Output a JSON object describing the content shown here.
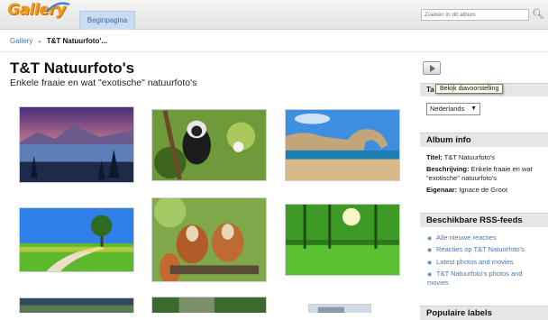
{
  "app": {
    "logo": "Gallery",
    "search_placeholder": "Zoeken in dit album"
  },
  "nav": {
    "home_tab": "Beginpagina"
  },
  "breadcrumb": {
    "root": "Gallery",
    "separator": "»",
    "current": "T&T Natuurfoto'..."
  },
  "album": {
    "title": "T&T Natuurfoto's",
    "description": "Enkele fraaie en wat \"exotische\" natuurfoto's"
  },
  "sidebar": {
    "slideshow_tooltip": "Bekijk diavoorstelling",
    "language_heading": "Ta",
    "language_selected": "Nederlands",
    "album_info": {
      "heading": "Album info",
      "title_label": "Titel:",
      "title_value": "T&T Natuurfoto's",
      "desc_label": "Beschrijving:",
      "desc_value": "Enkele fraaie en wat \"exotische\" natuurfoto's",
      "owner_label": "Eigenaar:",
      "owner_value": "Ignace de Groot"
    },
    "rss": {
      "heading": "Beschikbare RSS-feeds",
      "items": [
        "Alle nieuwe reacties",
        "Reacties op T&T Natuurfoto's",
        "Latest photos and movies",
        "T&T Natuurfoto's photos and movies"
      ]
    },
    "popular_heading": "Populaire labels"
  },
  "icons": [
    "logo-swoosh-icon",
    "search-icon",
    "slideshow-icon",
    "chevron-down-icon",
    "rss-icon"
  ],
  "colors": {
    "link": "#4b77b0",
    "tab_bg": "#c9dcf2",
    "logo": "#f29a1e",
    "box_head": "#e6e6e6"
  }
}
